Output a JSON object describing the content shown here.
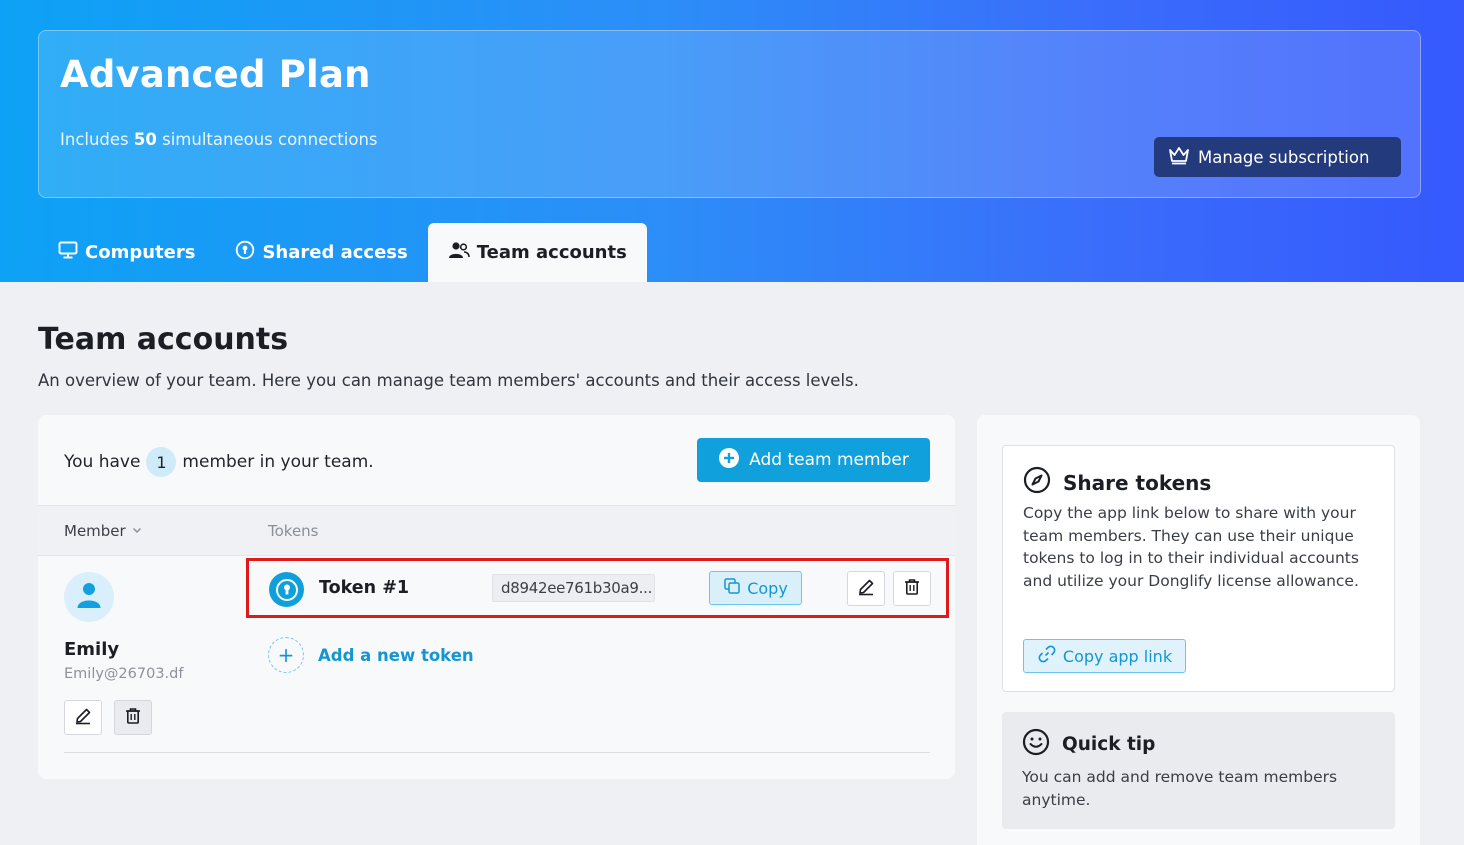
{
  "plan": {
    "title": "Advanced Plan",
    "subtitle_prefix": "Includes ",
    "connections": "50",
    "subtitle_suffix": " simultaneous connections",
    "manage_label": "Manage subscription"
  },
  "tabs": [
    {
      "label": "Computers",
      "icon": "monitor-icon",
      "active": false
    },
    {
      "label": "Shared access",
      "icon": "keyhole-icon",
      "active": false
    },
    {
      "label": "Team accounts",
      "icon": "users-icon",
      "active": true
    }
  ],
  "page": {
    "title": "Team accounts",
    "description": "An overview of your team. Here you can manage team members' accounts and their access levels."
  },
  "team": {
    "count_prefix": "You have",
    "count": "1",
    "count_suffix": "member in your team.",
    "add_member_label": "Add team member",
    "columns": {
      "member": "Member",
      "tokens": "Tokens"
    },
    "members": [
      {
        "name": "Emily",
        "email": "Emily@26703.df",
        "tokens": [
          {
            "name": "Token #1",
            "value": "d8942ee761b30a9...",
            "copy_label": "Copy"
          }
        ],
        "add_token_label": "Add a new token"
      }
    ]
  },
  "share": {
    "title": "Share tokens",
    "text": "Copy the app link below to share with your team members. They can use their unique tokens to log in to their individual accounts and utilize your Donglify license allowance.",
    "copy_link_label": "Copy app link"
  },
  "tip": {
    "title": "Quick tip",
    "text": "You can add and remove team members anytime."
  },
  "colors": {
    "accent": "#10a1dd",
    "manage_button": "#233a7c",
    "highlight_border": "#e01a1a"
  }
}
